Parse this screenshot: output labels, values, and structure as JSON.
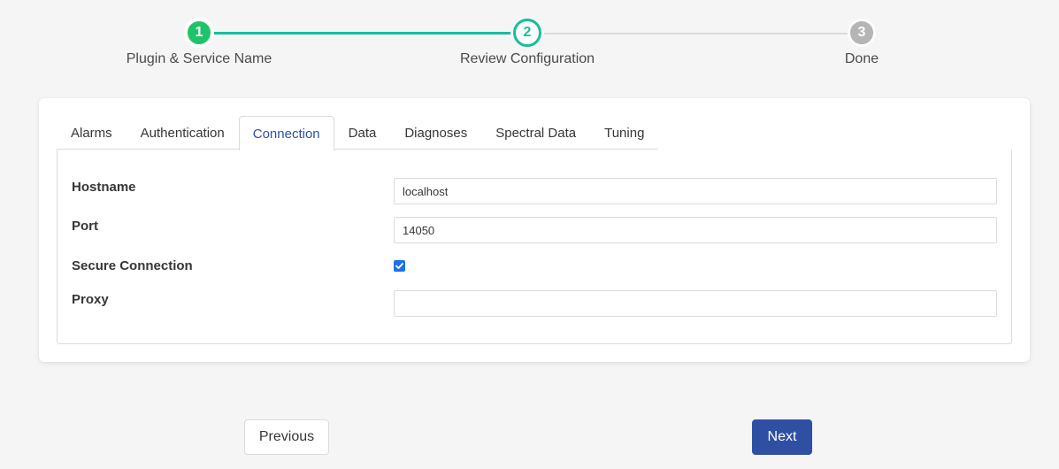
{
  "stepper": {
    "steps": [
      {
        "number": "1",
        "label": "Plugin & Service Name",
        "state": "complete",
        "color": "#1ec46a"
      },
      {
        "number": "2",
        "label": "Review Configuration",
        "state": "active",
        "color": "#1abc9c"
      },
      {
        "number": "3",
        "label": "Done",
        "state": "pending",
        "color": "#b5b5b5"
      }
    ]
  },
  "tabs": {
    "items": [
      "Alarms",
      "Authentication",
      "Connection",
      "Data",
      "Diagnoses",
      "Spectral Data",
      "Tuning"
    ],
    "active": "Connection"
  },
  "form": {
    "hostname": {
      "label": "Hostname",
      "value": "localhost"
    },
    "port": {
      "label": "Port",
      "value": "14050"
    },
    "secure": {
      "label": "Secure Connection",
      "checked": true
    },
    "proxy": {
      "label": "Proxy",
      "value": ""
    }
  },
  "buttons": {
    "previous": "Previous",
    "next": "Next"
  },
  "colors": {
    "accent": "#2f4fa3",
    "step_line": "#1abc9c"
  }
}
